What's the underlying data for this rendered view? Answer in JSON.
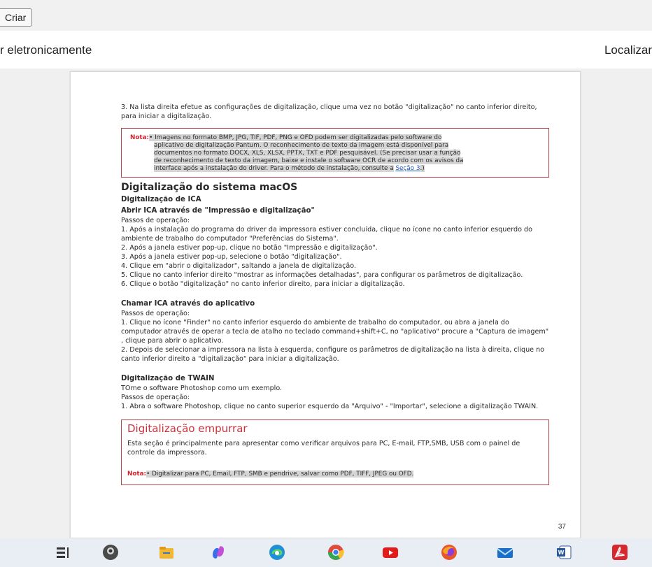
{
  "toolbar": {
    "create_label": "Criar"
  },
  "subbar": {
    "left_text": "r eletronicamente",
    "right_text": "Localizar"
  },
  "document": {
    "intro": "3. Na lista direita efetue as configurações de digitalização, clique uma vez no botão \"digitalização\" no canto inferior direito, para iniciar a digitalização.",
    "note1": {
      "label": "Nota:",
      "lines": [
        "• Imagens no formato BMP, JPG, TIF, PDF, PNG e OFD podem ser digitalizadas pelo software do",
        "aplicativo de digitalização Pantum. O reconhecimento de texto da imagem está disponível para",
        "documentos no formato DOCX, XLS, XLSX, PPTX, TXT e PDF pesquisável. (Se precisar usar a função",
        "de reconhecimento de texto da imagem, baixe e instale o software OCR de acordo com os avisos da",
        "interface após a instalação do driver. Para o método de instalação, consulte a"
      ],
      "link": "Seção 3",
      "end": ".)"
    },
    "section_mac": "Digitalização do sistema macOS",
    "ica_title": "Digitalização de ICA",
    "ica_open_title": "Abrir ICA através de \"Impressão e digitalização\"",
    "steps_label": "Passos de operação:",
    "ica_steps": [
      "1. Após a instalação do programa do driver da impressora estiver concluída, clique no ícone no canto inferior esquerdo do ambiente de trabalho do computador \"Preferências do Sistema\".",
      "2. Após a janela estiver pop-up, clique no botão \"Impressão e digitalização\".",
      "3. Após a janela estiver pop-up, selecione o botão \"digitalização\".",
      "4. Clique em \"abrir o digitalizador\", saltando a janela de digitalização.",
      "5. Clique no canto inferior direito \"mostrar as informações detalhadas\", para configurar os parâmetros de digitalização.",
      "6. Clique o botão \"digitalização\" no canto inferior direito, para iniciar a digitalização."
    ],
    "app_title": "Chamar ICA através do aplicativo",
    "app_steps": [
      "1. Clique no ícone \"Finder\" no canto inferior esquerdo do ambiente de trabalho do computador, ou abra a janela do computador através de operar a tecla de atalho no teclado command+shift+C, no \"aplicativo\" procure a \"Captura de imagem\" , clique para abrir o aplicativo.",
      "2. Depois de selecionar a impressora na lista à esquerda, configure os parâmetros de digitalização na lista à direita, clique no canto inferior direito a \"digitalização\" para iniciar a digitalização."
    ],
    "twain_title": "Digitalização de TWAIN",
    "twain_intro": "TOme o software Photoshop como um exemplo.",
    "twain_steps": [
      "1. Abra o software Photoshop, clique no canto superior esquerdo da \"Arquivo\" - \"Importar\", selecione a digitalização TWAIN."
    ],
    "push_title": "Digitalização empurrar",
    "push_text": "Esta seção é principalmente para apresentar como verificar arquivos para PC, E-mail, FTP,SMB, USB com o painel de controle da impressora.",
    "push_note_label": "Nota:",
    "push_note_text": "• Digitalizar para PC, Email, FTP, SMB e pendrive, salvar como PDF, TIFF, JPEG ou OFD.",
    "page_number": "37"
  },
  "taskbar": {
    "icons": [
      "task-view-icon",
      "webcam-app-icon",
      "file-explorer-icon",
      "copilot-icon",
      "edge-icon",
      "chrome-icon",
      "youtube-icon",
      "firefox-icon",
      "mail-icon",
      "word-icon",
      "acrobat-icon"
    ],
    "colors": {
      "explorer": "#f2b630",
      "copilot": "#3b6ee8",
      "edge": "#1f8fd6",
      "chrome": "#e04a3a",
      "youtube": "#e21b1b",
      "firefox": "#e8562a",
      "mail": "#1a6fc9",
      "word": "#2b5797",
      "acrobat": "#d7282f"
    }
  }
}
